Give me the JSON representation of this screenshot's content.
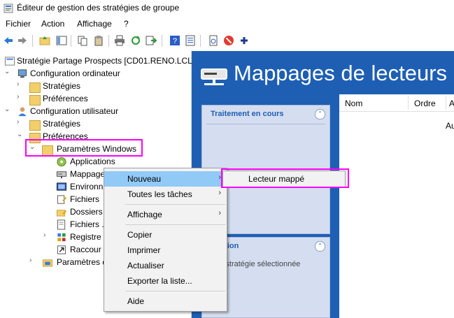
{
  "window": {
    "title": "Éditeur de gestion des stratégies de groupe"
  },
  "menubar": {
    "items": [
      "Fichier",
      "Action",
      "Affichage",
      "?"
    ]
  },
  "toolbar": {
    "icons": [
      "back-arrow-icon",
      "forward-arrow-icon",
      "up-folder-icon",
      "show-hide-tree-icon",
      "copy-icon",
      "paste-icon",
      "print-icon",
      "refresh-icon",
      "export-icon",
      "help-icon",
      "properties-icon",
      "stop-icon",
      "add-icon"
    ]
  },
  "tree": {
    "root": "Stratégie Partage Prospects [CD01.RENO.LCL]",
    "computer_config": "Configuration ordinateur",
    "computer_strategies": "Stratégies",
    "computer_preferences": "Préférences",
    "user_config": "Configuration utilisateur",
    "user_strategies": "Stratégies",
    "user_preferences": "Préférences",
    "windows_settings": "Paramètres Windows",
    "applications": "Applications",
    "drive_maps": "Mappage",
    "environment": "Environn",
    "files": "Fichiers",
    "folders": "Dossiers",
    "ini_files": "Fichiers .",
    "registry": "Registre",
    "shortcuts": "Raccour",
    "panel_settings": "Paramètres d"
  },
  "right": {
    "title": "Mappages de lecteurs",
    "panel1_title": "Traitement en cours",
    "panel2_title": "cription",
    "panel2_text": "une stratégie sélectionnée",
    "columns": [
      "Nom",
      "Ordre",
      "A"
    ],
    "cell_partial": "Au"
  },
  "context_menu": {
    "items": [
      "Nouveau",
      "Toutes les tâches",
      "Affichage",
      "Copier",
      "Imprimer",
      "Actualiser",
      "Exporter la liste...",
      "Aide"
    ],
    "submenu_item": "Lecteur mappé"
  },
  "colors": {
    "highlight": "#ff00ff",
    "accent_blue": "#1e5fb4",
    "menu_selected": "#91c9f7"
  }
}
